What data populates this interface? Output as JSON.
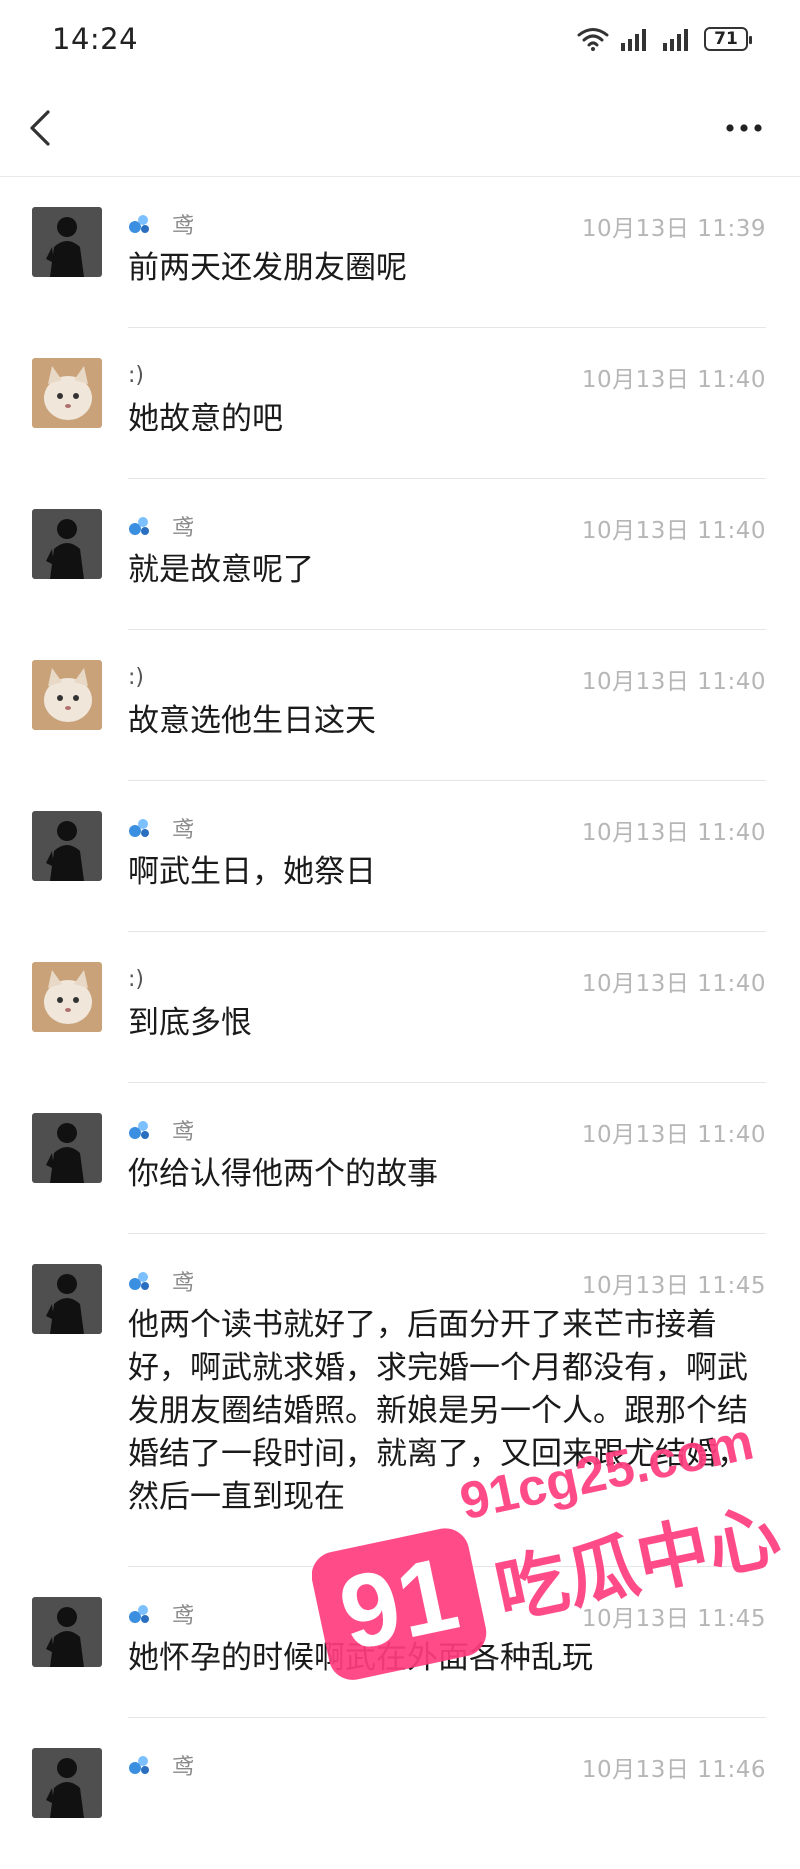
{
  "status_bar": {
    "time": "14:24",
    "battery": "71"
  },
  "messages": [
    {
      "sender": "鸢",
      "time": "10月13日 11:39",
      "text": "前两天还发朋友圈呢",
      "avatar": "silhouette"
    },
    {
      "sender": ":)",
      "time": "10月13日 11:40",
      "text": "她故意的吧",
      "avatar": "cat"
    },
    {
      "sender": "鸢",
      "time": "10月13日 11:40",
      "text": "就是故意呢了",
      "avatar": "silhouette"
    },
    {
      "sender": ":)",
      "time": "10月13日 11:40",
      "text": "故意选他生日这天",
      "avatar": "cat"
    },
    {
      "sender": "鸢",
      "time": "10月13日 11:40",
      "text": "啊武生日，她祭日",
      "avatar": "silhouette"
    },
    {
      "sender": ":)",
      "time": "10月13日 11:40",
      "text": "到底多恨",
      "avatar": "cat"
    },
    {
      "sender": "鸢",
      "time": "10月13日 11:40",
      "text": "你给认得他两个的故事",
      "avatar": "silhouette"
    },
    {
      "sender": "鸢",
      "time": "10月13日 11:45",
      "text": "他两个读书就好了，后面分开了来芒市接着好，啊武就求婚，求完婚一个月都没有，啊武发朋友圈结婚照。新娘是另一个人。跟那个结婚结了一段时间，就离了，又回来跟尤结婚，然后一直到现在",
      "avatar": "silhouette"
    },
    {
      "sender": "鸢",
      "time": "10月13日 11:45",
      "text": "她怀孕的时候啊武在外面各种乱玩",
      "avatar": "silhouette"
    },
    {
      "sender": "鸢",
      "time": "10月13日 11:46",
      "text": "",
      "avatar": "silhouette"
    }
  ],
  "watermark": {
    "number": "91",
    "domain": "91cg25.com",
    "brand": "吃瓜中心"
  },
  "colors": {
    "watermark": "#ff3d7f",
    "badge": "#3b8fe0"
  }
}
